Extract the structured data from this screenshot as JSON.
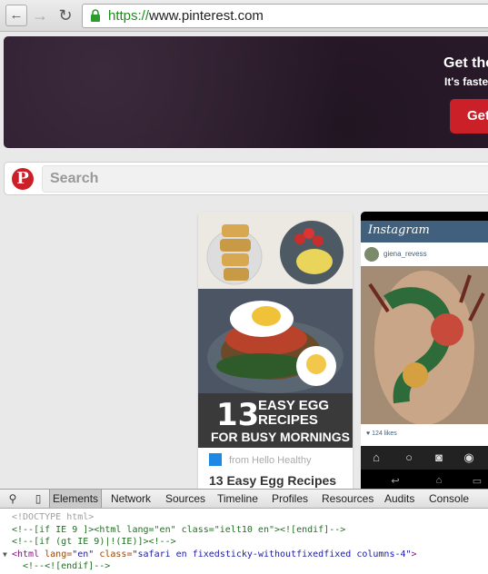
{
  "browser": {
    "url_scheme": "https://",
    "url_host": "www.pinterest.com",
    "back_label": "←",
    "forward_label": "→",
    "reload_label": "↻"
  },
  "hero": {
    "title": "Get the",
    "subtitle": "It's faste",
    "button_label": "Get"
  },
  "search": {
    "logo": "P",
    "placeholder": "Search"
  },
  "pins": [
    {
      "overlay_number": "13",
      "overlay_line1": "EASY EGG",
      "overlay_line2": "RECIPES",
      "overlay_line3": "FOR BUSY MORNINGS",
      "source": "from Hello Healthy",
      "title": "13 Easy Egg Recipes"
    },
    {
      "app_name": "Instagram",
      "username": "giena_revess",
      "likes": "♥ 124 likes"
    }
  ],
  "devtools": {
    "tabs": [
      "Elements",
      "Network",
      "Sources",
      "Timeline",
      "Profiles",
      "Resources",
      "Audits",
      "Console"
    ],
    "active_tab": "Elements",
    "code": {
      "line1": "<!DOCTYPE html>",
      "line2": "<!--[if IE 9 ]><html lang=\"en\" class=\"ielt10 en\"><![endif]-->",
      "line3": "<!--[if (gt IE 9)|!(IE)]><!-->",
      "line4_tag_open": "<html",
      "line4_attr1": " lang=",
      "line4_val1": "\"en\"",
      "line4_attr2": " class=",
      "line4_val2": "\"safari en fixedsticky-withoutfixedfixed columns-4\"",
      "line4_tag_close": ">",
      "line5": "<!--<![endif]-->"
    }
  },
  "colors": {
    "pinterest_red": "#cb2027",
    "https_green": "#1a8c1a",
    "instagram_blue": "#40607e"
  }
}
